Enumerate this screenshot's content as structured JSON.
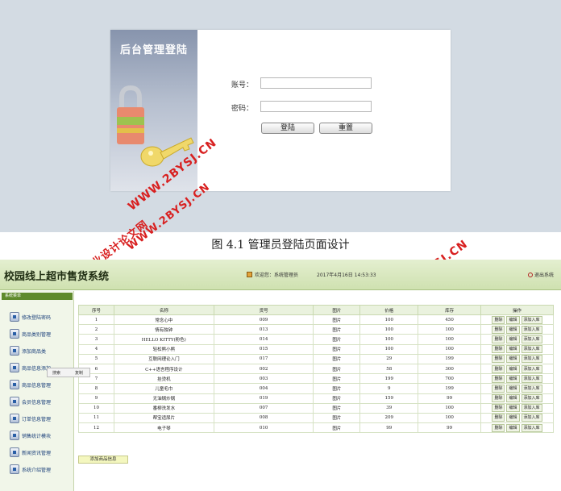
{
  "login": {
    "title": "后台管理登陆",
    "account_label": "账号：",
    "account_value": "",
    "password_label": "密码：",
    "password_value": "",
    "login_button": "登陆",
    "reset_button": "重置"
  },
  "watermark": {
    "brand": "毕业设计论文网",
    "url": "WWW.2BYSJ.CN"
  },
  "caption": "图 4.1  管理员登陆页面设计",
  "admin": {
    "title": "校园线上超市售货系统",
    "welcome": "欢迎您：系统管理员",
    "datetime": "2017年4月16日 14:53:33",
    "logout": "退出系统",
    "sidebar_title": "系统菜单",
    "menu": [
      "修改登陆密码",
      "商品类别管理",
      "添加商品类",
      "商品信息添加",
      "商品信息管理",
      "会员信息管理",
      "订单信息管理",
      "销售统计模块",
      "新闻资讯管理",
      "系统介绍管理"
    ],
    "context_menu": {
      "search": "搜索",
      "copy": "复制"
    },
    "table": {
      "headers": [
        "序号",
        "名称",
        "货号",
        "图片",
        "价格",
        "库存",
        "操作"
      ],
      "rows": [
        [
          "1",
          "常念心中",
          "009",
          "图片",
          "100",
          "450"
        ],
        [
          "2",
          "情有独钟",
          "013",
          "图片",
          "100",
          "100"
        ],
        [
          "3",
          "HELLO KITTY(粉色)",
          "014",
          "图片",
          "100",
          "100"
        ],
        [
          "4",
          "轻松熊小熊",
          "015",
          "图片",
          "100",
          "100"
        ],
        [
          "5",
          "互联网理论入门",
          "017",
          "图片",
          "29",
          "199"
        ],
        [
          "6",
          "C++语言程序设计",
          "002",
          "图片",
          "58",
          "300"
        ],
        [
          "7",
          "挂烫机",
          "003",
          "图片",
          "199",
          "700"
        ],
        [
          "8",
          "儿童毛巾",
          "004",
          "图片",
          "9",
          "199"
        ],
        [
          "9",
          "无油锅炒锅",
          "019",
          "图片",
          "159",
          "99"
        ],
        [
          "10",
          "番柳洗发水",
          "007",
          "图片",
          "39",
          "100"
        ],
        [
          "11",
          "帮宝适尿片",
          "008",
          "图片",
          "209",
          "100"
        ],
        [
          "12",
          "电子琴",
          "010",
          "图片",
          "99",
          "99"
        ]
      ],
      "actions": [
        "删除",
        "编辑",
        "添加入库"
      ]
    },
    "add_button": "添加商品信息"
  },
  "colors": {
    "login_bg": "#d3dbe3",
    "admin_header": "#cfe1b0",
    "watermark": "#d82020",
    "sidebar_head": "#5f8a2c"
  }
}
